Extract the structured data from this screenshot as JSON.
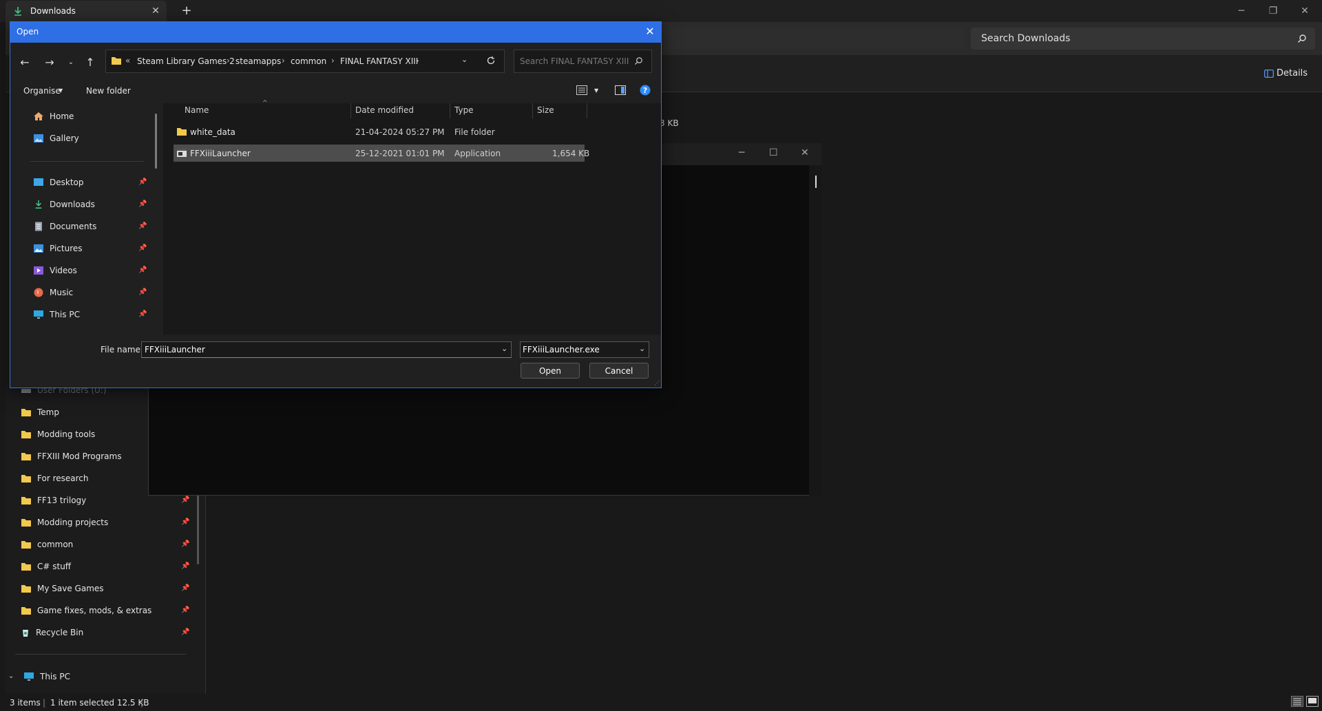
{
  "explorer": {
    "tab_title": "Downloads",
    "search_placeholder": "Search Downloads",
    "details_label": "Details",
    "size_fragment_1": "3 KB",
    "sidebar_items": [
      {
        "label": "User Folders (U:)",
        "pinned": false
      },
      {
        "label": "Temp",
        "pinned": false
      },
      {
        "label": "Modding tools",
        "pinned": false
      },
      {
        "label": "FFXIII Mod Programs",
        "pinned": false
      },
      {
        "label": "For research",
        "pinned": false
      },
      {
        "label": "FF13 trilogy",
        "pinned": true
      },
      {
        "label": "Modding projects",
        "pinned": true
      },
      {
        "label": "common",
        "pinned": true
      },
      {
        "label": "C# stuff",
        "pinned": true
      },
      {
        "label": "My Save Games",
        "pinned": true
      },
      {
        "label": "Game fixes, mods, & extras",
        "pinned": true
      },
      {
        "label": "Recycle Bin",
        "pinned": true
      }
    ],
    "this_pc_label": "This PC",
    "status": {
      "item_count": "3 items",
      "selection": "1 item selected  12.5 KB"
    },
    "colors": {
      "accent": "#2f6fe6",
      "folder": "#f2c94c"
    }
  },
  "dialog": {
    "title": "Open",
    "breadcrumb": [
      "Steam Library Games 2",
      "steamapps",
      "common",
      "FINAL FANTASY XIII"
    ],
    "overflow_marker": "«",
    "search_placeholder": "Search FINAL FANTASY XIII",
    "toolbar": {
      "organise_label": "Organise",
      "new_folder_label": "New folder"
    },
    "nav_items": [
      {
        "label": "Home",
        "icon": "home-icon",
        "pinned": false
      },
      {
        "label": "Gallery",
        "icon": "gallery-icon",
        "pinned": false
      },
      {
        "label": "Desktop",
        "icon": "desktop-icon",
        "pinned": true
      },
      {
        "label": "Downloads",
        "icon": "download-icon",
        "pinned": true
      },
      {
        "label": "Documents",
        "icon": "documents-icon",
        "pinned": true
      },
      {
        "label": "Pictures",
        "icon": "pictures-icon",
        "pinned": true
      },
      {
        "label": "Videos",
        "icon": "videos-icon",
        "pinned": true
      },
      {
        "label": "Music",
        "icon": "music-icon",
        "pinned": true
      },
      {
        "label": "This PC",
        "icon": "pc-icon",
        "pinned": true
      }
    ],
    "columns": {
      "name": "Name",
      "date": "Date modified",
      "type": "Type",
      "size": "Size"
    },
    "files": [
      {
        "name": "white_data",
        "date": "21-04-2024 05:27 PM",
        "type": "File folder",
        "size": "",
        "icon": "folder-icon",
        "selected": false
      },
      {
        "name": "FFXiiiLauncher",
        "date": "25-12-2021 01:01 PM",
        "type": "Application",
        "size": "1,654 KB",
        "icon": "application-icon",
        "selected": true
      }
    ],
    "file_name_label": "File name:",
    "file_name_value": "FFXiiiLauncher",
    "file_type_value": "FFXiiiLauncher.exe",
    "open_label": "Open",
    "cancel_label": "Cancel"
  }
}
